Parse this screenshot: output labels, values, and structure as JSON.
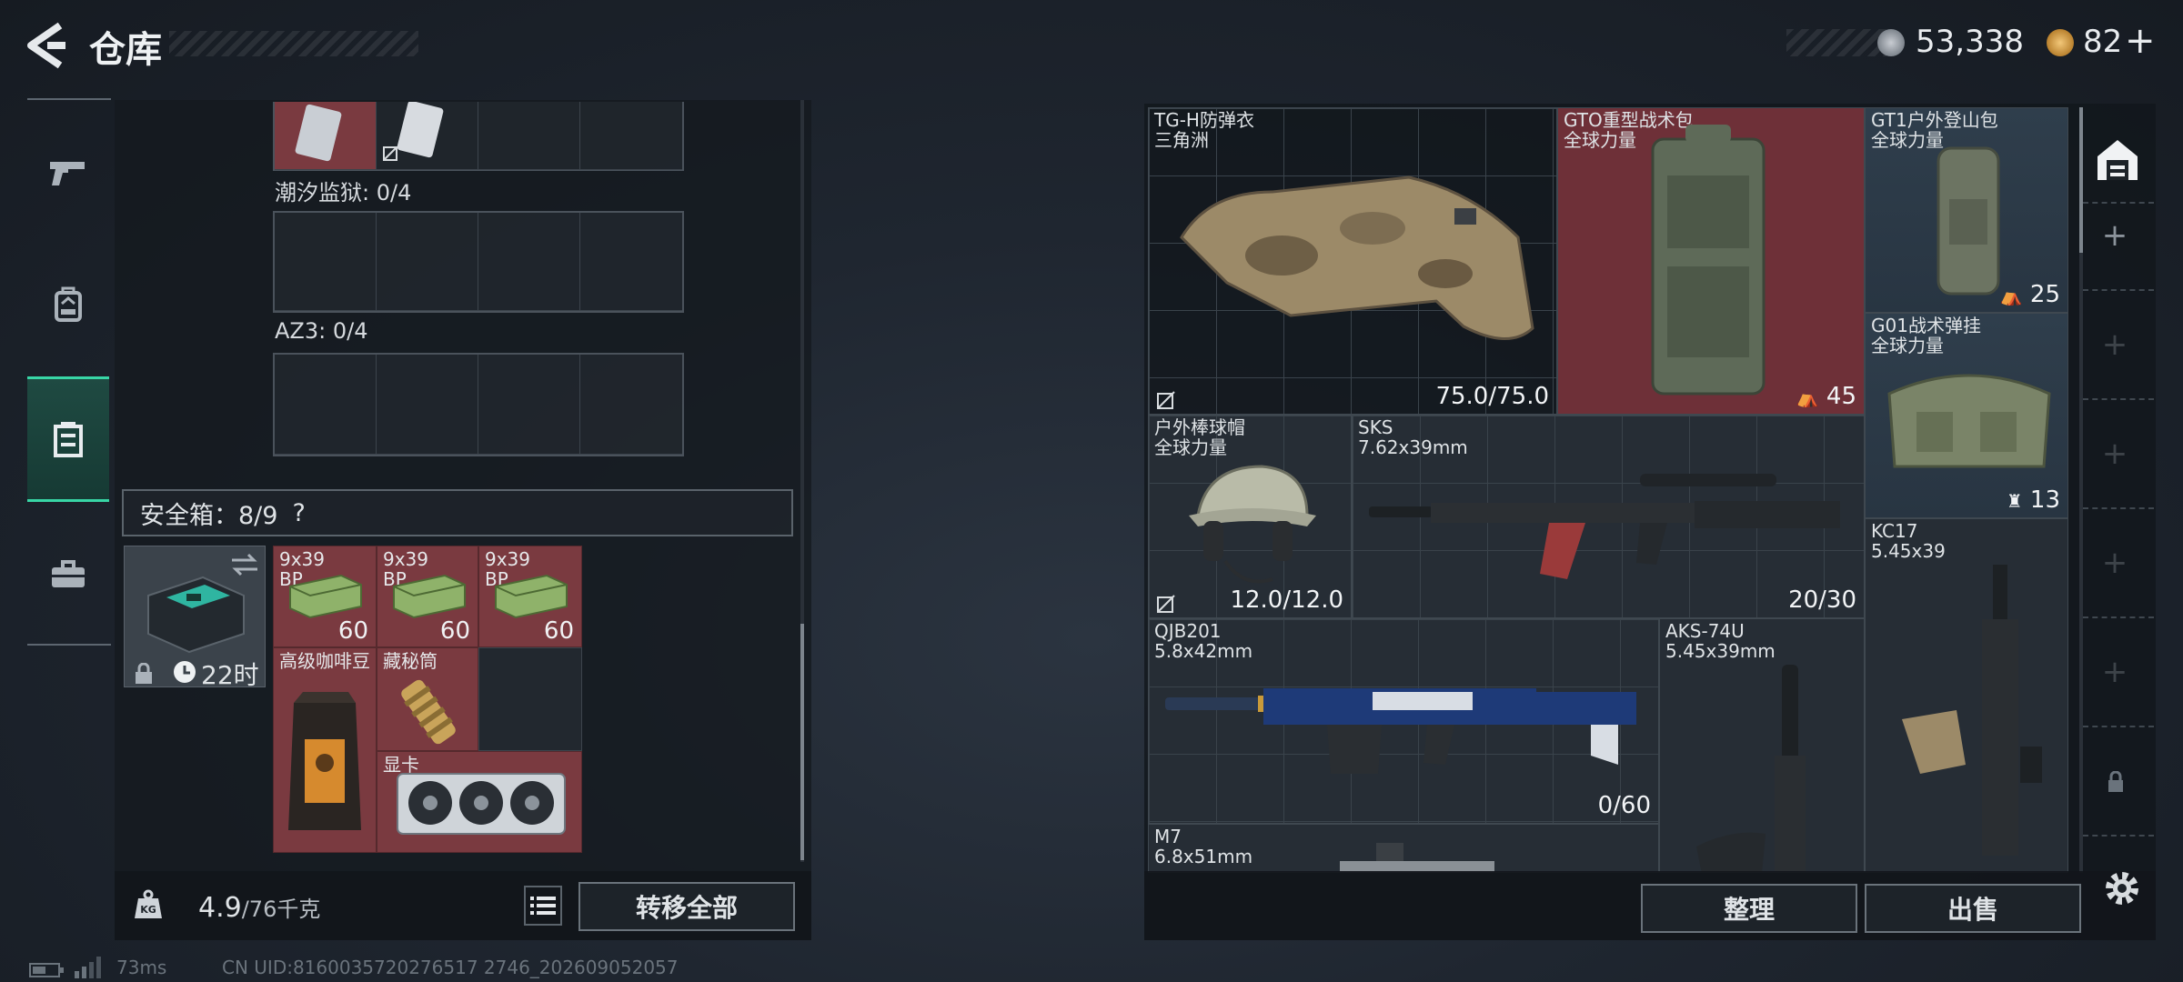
{
  "header": {
    "title": "仓库",
    "currency_1": "53,338",
    "currency_2": "82",
    "plus": "+"
  },
  "left_rail": {
    "items": [
      "pistol-icon",
      "backpack-icon",
      "safebox-icon",
      "toolbox-icon"
    ],
    "active_index": 2
  },
  "left_panel": {
    "sections": [
      {
        "label": "潮汐监狱: 0/4"
      },
      {
        "label": "AZ3: 0/4"
      }
    ],
    "safebox_label": "安全箱：8/9",
    "help": "?",
    "safebox_timer": "22时",
    "safebox_items": [
      {
        "name": "9x39\nBP",
        "count": "60"
      },
      {
        "name": "9x39\nBP",
        "count": "60"
      },
      {
        "name": "9x39\nBP",
        "count": "60"
      },
      {
        "name": "高级咖啡豆",
        "count": ""
      },
      {
        "name": "藏秘筒",
        "count": ""
      },
      {
        "name": "显卡",
        "count": ""
      }
    ],
    "weight_current": "4.9",
    "weight_max": "/76千克",
    "transfer_all": "转移全部"
  },
  "right_panel": {
    "items": [
      {
        "name": "TG-H防弹衣",
        "sub": "三角洲",
        "value": "75.0/75.0"
      },
      {
        "name": "GTO重型战术包",
        "sub": "全球力量",
        "value": "45"
      },
      {
        "name": "GT1户外登山包",
        "sub": "全球力量",
        "value": "25"
      },
      {
        "name": "G01战术弹挂",
        "sub": "全球力量",
        "value": "13"
      },
      {
        "name": "户外棒球帽",
        "sub": "全球力量",
        "value": "12.0/12.0"
      },
      {
        "name": "SKS",
        "sub": "7.62x39mm",
        "value": "20/30"
      },
      {
        "name": "KC17",
        "sub": "5.45x39",
        "value": ""
      },
      {
        "name": "QJB201",
        "sub": "5.8x42mm",
        "value": "0/60"
      },
      {
        "name": "AKS-74U",
        "sub": "5.45x39mm",
        "value": ""
      },
      {
        "name": "M7",
        "sub": "6.8x51mm",
        "value": ""
      }
    ],
    "sort_label": "整理",
    "sell_label": "出售"
  },
  "status": {
    "ping": "73ms",
    "uid": "CN UID:8160035720276517 2746_202609052057"
  },
  "colors": {
    "accent": "#38d6a6",
    "item_red": "#7a3a40",
    "item_blue": "#2f3e4c"
  }
}
